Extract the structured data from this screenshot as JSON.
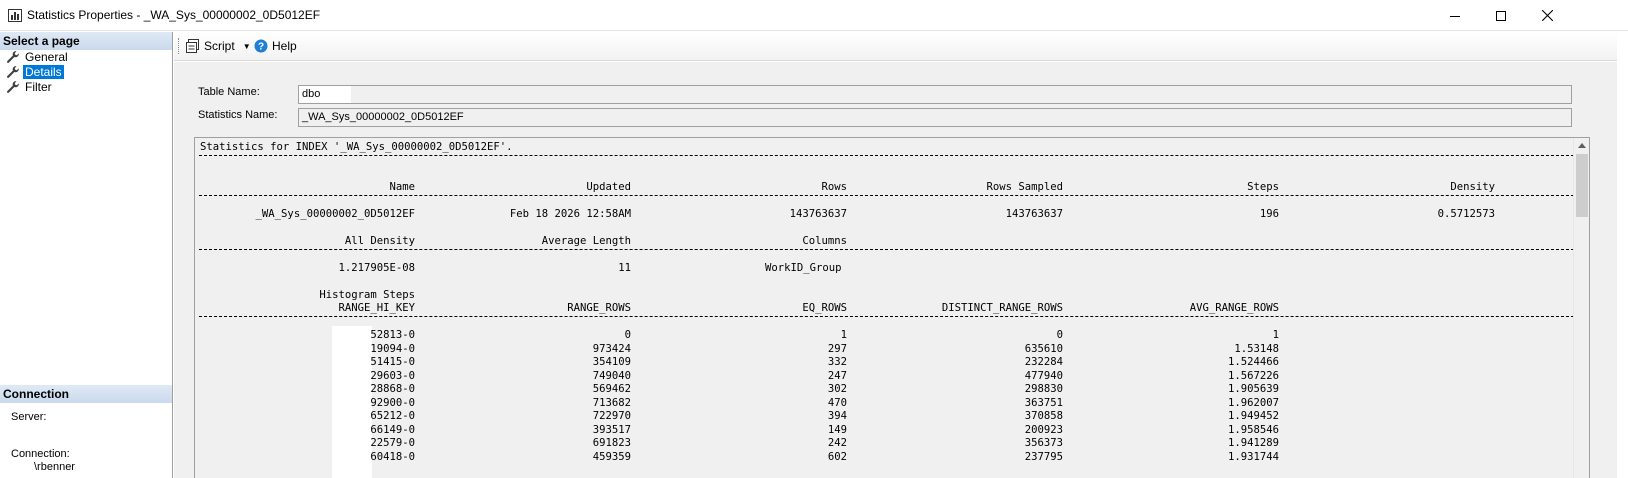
{
  "window": {
    "title": "Statistics Properties - _WA_Sys_00000002_0D5012EF",
    "app_icon": "bar-chart-icon"
  },
  "left_pane": {
    "select_header": "Select a page",
    "pages": [
      {
        "label": "General",
        "icon": "wrench-icon",
        "selected": false
      },
      {
        "label": "Details",
        "icon": "wrench-icon",
        "selected": true
      },
      {
        "label": "Filter",
        "icon": "wrench-icon",
        "selected": false
      }
    ],
    "connection_header": "Connection",
    "server_label": "Server:",
    "connection_label": "Connection:",
    "connection_value": "\\rbenner"
  },
  "toolbar": {
    "script_label": "Script",
    "help_label": "Help"
  },
  "form": {
    "table_name_label": "Table Name:",
    "table_name_value": "dbo",
    "stats_name_label": "Statistics Name:",
    "stats_name_value": "_WA_Sys_00000002_0D5012EF"
  },
  "details": {
    "header_line": "Statistics for INDEX '_WA_Sys_00000002_0D5012EF'.",
    "summary_headers": [
      "Name",
      "Updated",
      "Rows",
      "Rows Sampled",
      "Steps",
      "Density"
    ],
    "summary_values": [
      "_WA_Sys_00000002_0D5012EF",
      "Feb 18 2026 12:58AM",
      "143763637",
      "143763637",
      "196",
      "0.5712573"
    ],
    "density_headers": [
      "All Density",
      "Average Length",
      "Columns"
    ],
    "density_values": [
      "1.217905E-08",
      "11",
      "WorkID_Group"
    ],
    "histogram_title": "Histogram Steps",
    "histogram_headers": [
      "RANGE_HI_KEY",
      "RANGE_ROWS",
      "EQ_ROWS",
      "DISTINCT_RANGE_ROWS",
      "AVG_RANGE_ROWS"
    ],
    "histogram_rows": [
      [
        "52813-0",
        "0",
        "1",
        "0",
        "1"
      ],
      [
        "19094-0",
        "973424",
        "297",
        "635610",
        "1.53148"
      ],
      [
        "51415-0",
        "354109",
        "332",
        "232284",
        "1.524466"
      ],
      [
        "29603-0",
        "749040",
        "247",
        "477940",
        "1.567226"
      ],
      [
        "28868-0",
        "569462",
        "302",
        "298830",
        "1.905639"
      ],
      [
        "92900-0",
        "713682",
        "470",
        "363751",
        "1.962007"
      ],
      [
        "65212-0",
        "722970",
        "394",
        "370858",
        "1.949452"
      ],
      [
        "66149-0",
        "393517",
        "149",
        "200923",
        "1.958546"
      ],
      [
        "22579-0",
        "691823",
        "242",
        "356373",
        "1.941289"
      ],
      [
        "60418-0",
        "459359",
        "602",
        "237795",
        "1.931744"
      ]
    ]
  }
}
